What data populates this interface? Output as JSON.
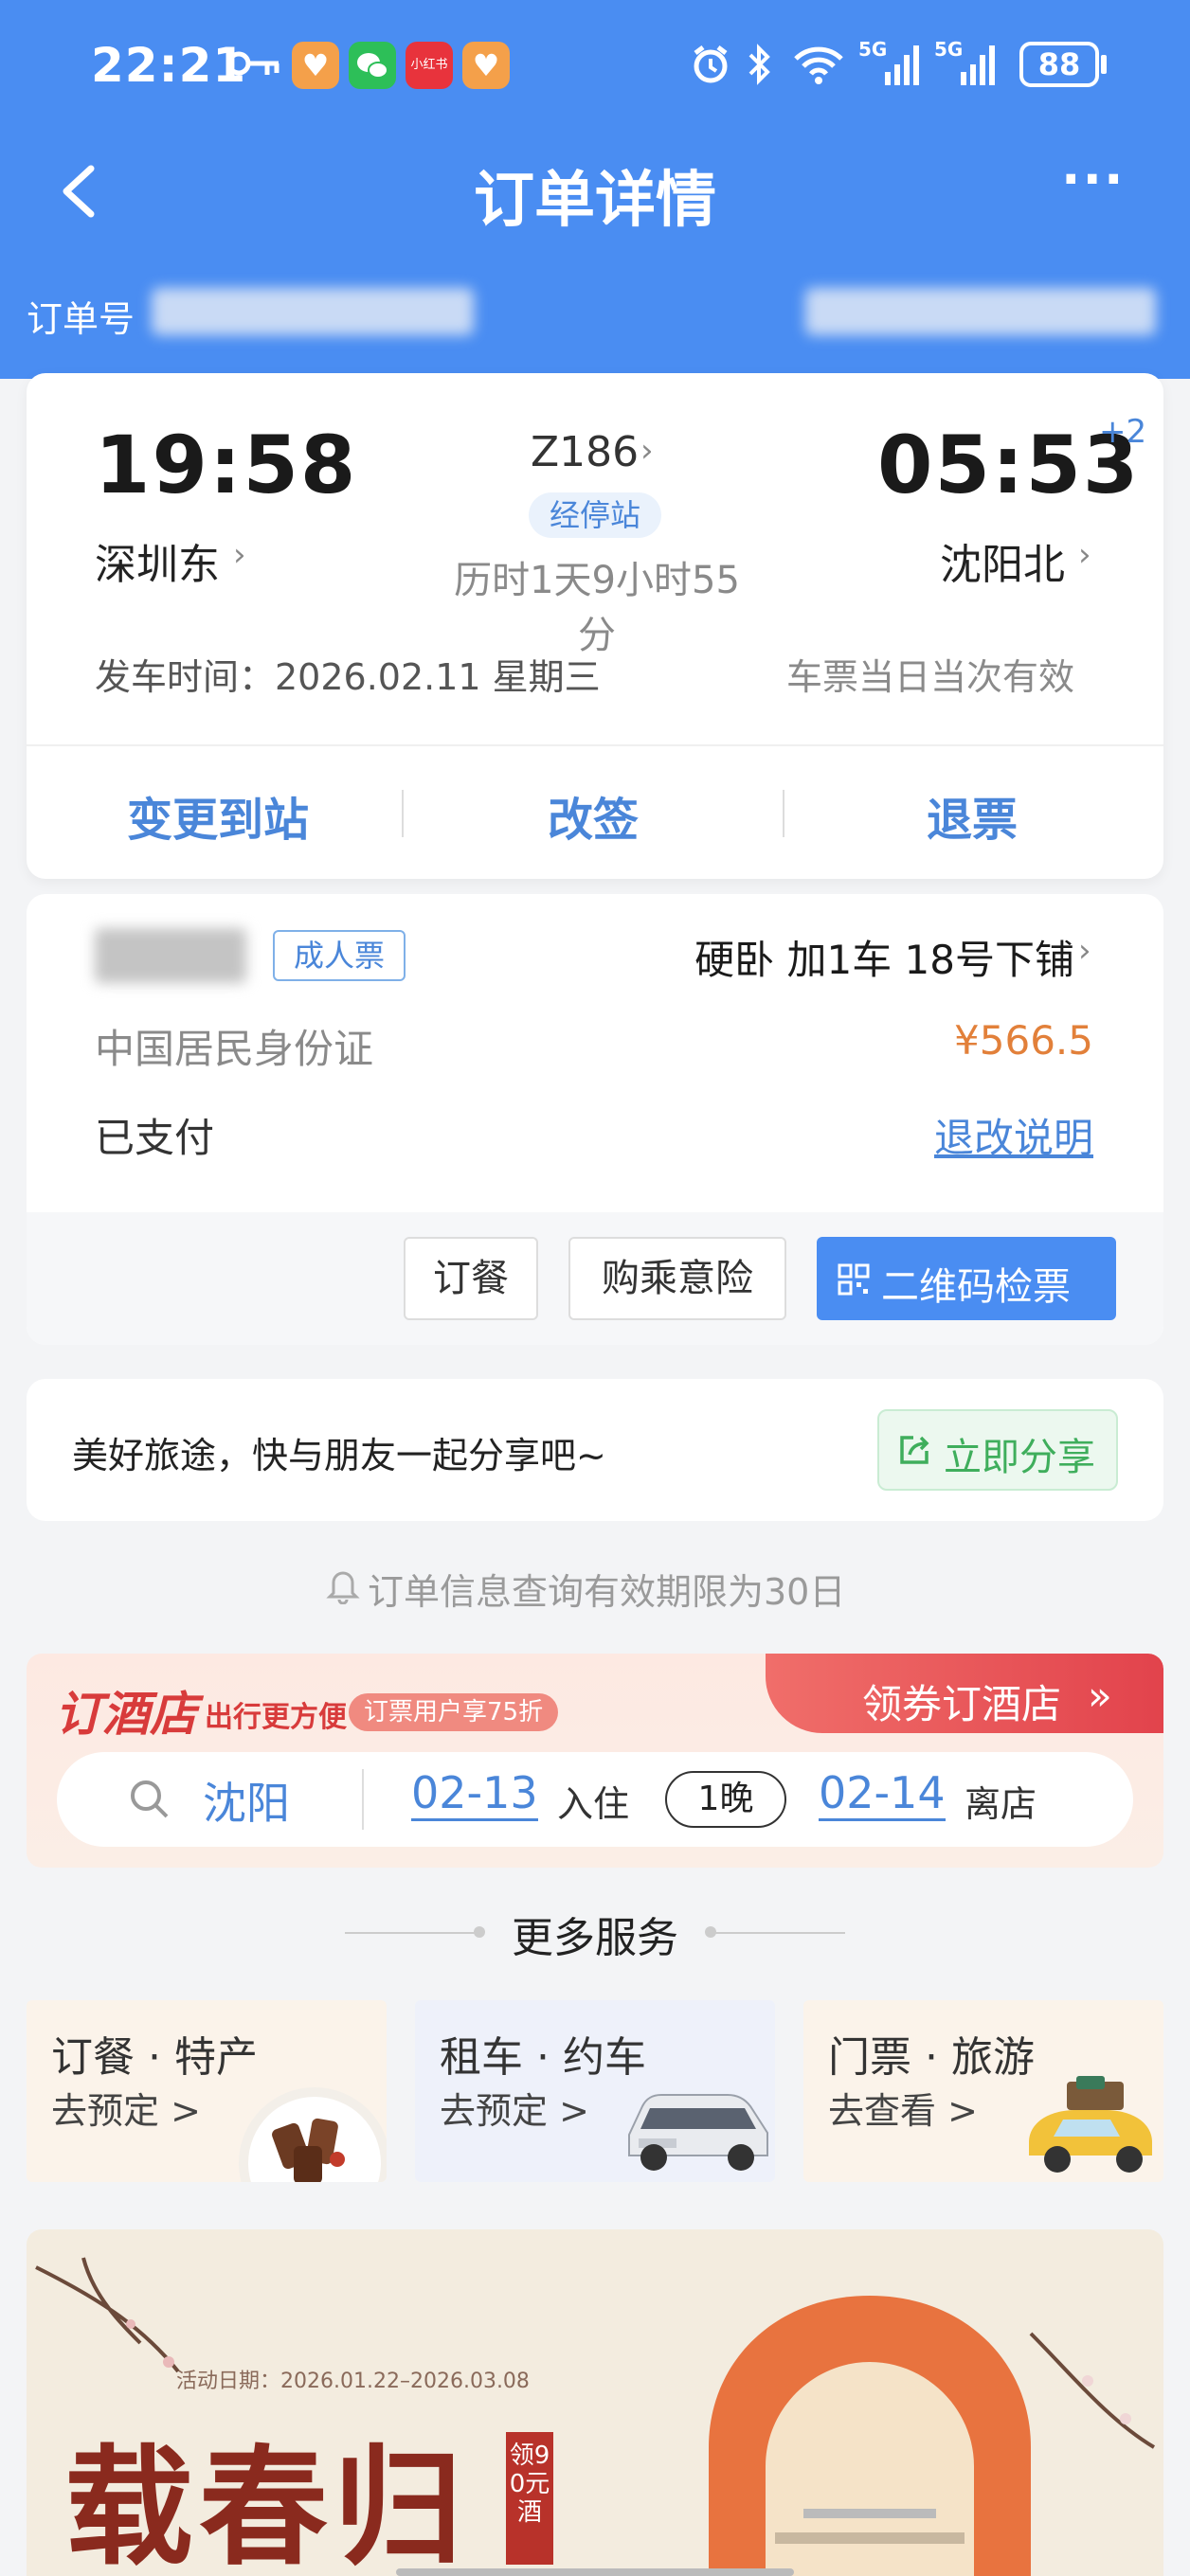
{
  "status_bar": {
    "time": "22:21",
    "signal_1": "5G",
    "signal_2": "5G",
    "battery": "88",
    "app_badge": "小红书"
  },
  "nav": {
    "title": "订单详情",
    "more": "···"
  },
  "order": {
    "label": "订单号"
  },
  "train": {
    "depart_time": "19:58",
    "arrive_time": "05:53",
    "day_offset": "+2",
    "number": "Z186",
    "stops_label": "经停站",
    "duration": "历时1天9小时55分",
    "from_station": "深圳东",
    "to_station": "沈阳北",
    "depart_date": "发车时间：2026.02.11 星期三",
    "validity": "车票当日当次有效"
  },
  "actions": {
    "change_station": "变更到站",
    "reschedule": "改签",
    "refund": "退票"
  },
  "passenger": {
    "ticket_type": "成人票",
    "seat": "硬卧 加1车 18号下铺",
    "id_type": "中国居民身份证",
    "price": "¥566.5",
    "payment_status": "已支付",
    "refund_rules": "退改说明"
  },
  "buttons": {
    "meal": "订餐",
    "insurance": "购乘意险",
    "qr": "二维码检票"
  },
  "share": {
    "text": "美好旅途，快与朋友一起分享吧~",
    "button": "立即分享"
  },
  "notice": "订单信息查询有效期限为30日",
  "hotel": {
    "brand": "订酒店",
    "slogan": "出行更方便",
    "promo": "订票用户享75折",
    "cta": "领券订酒店",
    "city": "沈阳",
    "checkin_date": "02-13",
    "checkin_label": "入住",
    "nights": "1晚",
    "checkout_date": "02-14",
    "checkout_label": "离店"
  },
  "more_services": {
    "title": "更多服务",
    "items": [
      {
        "title": "订餐 · 特产",
        "sub": "去预定 >"
      },
      {
        "title": "租车 · 约车",
        "sub": "去预定 >"
      },
      {
        "title": "门票 · 旅游",
        "sub": "去查看 >"
      }
    ]
  },
  "banner": {
    "date": "活动日期：2026.01.22–2026.03.08",
    "title": "载春归",
    "seal": "领90元酒"
  },
  "colors": {
    "header": "#4a8df2",
    "accent": "#4a86d9",
    "price": "#e2803a",
    "share": "#3fae5c",
    "hotel": "#e04a46"
  }
}
